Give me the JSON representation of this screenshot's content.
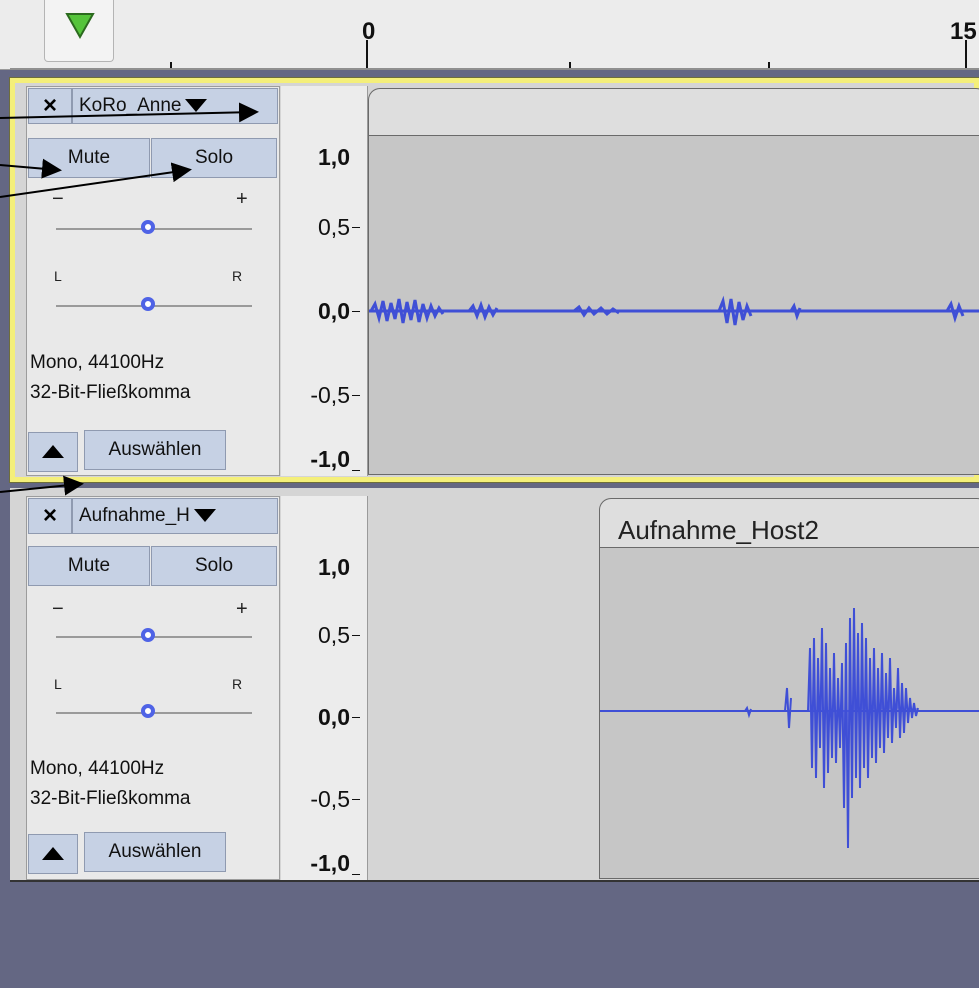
{
  "timeline": {
    "play_icon": "play-triangle-icon",
    "labels": [
      "0",
      "15"
    ]
  },
  "tracks": [
    {
      "name": "KoRo_Anne",
      "mute_label": "Mute",
      "solo_label": "Solo",
      "gain_minus": "−",
      "gain_plus": "+",
      "pan_left": "L",
      "pan_right": "R",
      "format_line1": "Mono, 44100Hz",
      "format_line2": "32-Bit-Fließkomma",
      "select_label": "Auswählen",
      "scale": [
        "1,0",
        "0,5",
        "0,0",
        "-0,5",
        "-1,0"
      ],
      "clip_title": "",
      "selected": true,
      "gain_level": 0.5,
      "pan_level": 0.5
    },
    {
      "name": "Aufnahme_H",
      "mute_label": "Mute",
      "solo_label": "Solo",
      "gain_minus": "−",
      "gain_plus": "+",
      "pan_left": "L",
      "pan_right": "R",
      "format_line1": "Mono, 44100Hz",
      "format_line2": "32-Bit-Fließkomma",
      "select_label": "Auswählen",
      "scale": [
        "1,0",
        "0,5",
        "0,0",
        "-0,5",
        "-1,0"
      ],
      "clip_title": "Aufnahme_Host2",
      "selected": false,
      "gain_level": 0.5,
      "pan_level": 0.5
    }
  ],
  "colors": {
    "waveform": "#3f4fd6",
    "selection_border": "#f4ef7a",
    "button_bg": "#c6d1e4",
    "background": "#646783"
  }
}
